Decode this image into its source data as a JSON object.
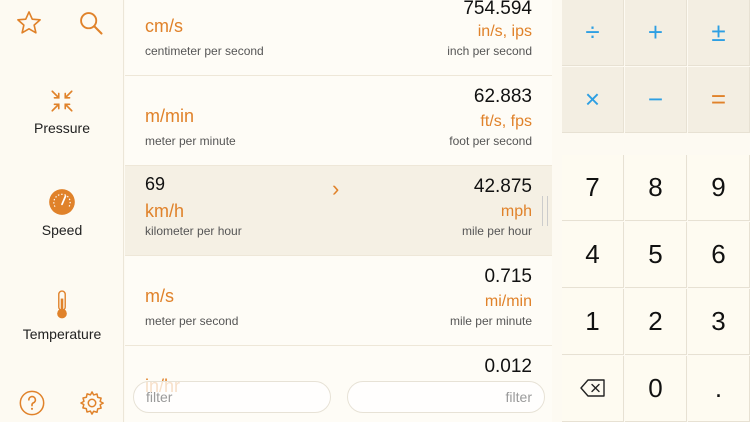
{
  "sidebar": {
    "top": {
      "favorites_icon": "star-icon",
      "search_icon": "search-icon"
    },
    "categories": [
      {
        "label": "Pressure",
        "icon": "pressure-icon"
      },
      {
        "label": "Speed",
        "icon": "speedometer-icon"
      },
      {
        "label": "Temperature",
        "icon": "thermometer-icon"
      }
    ],
    "bottom": {
      "help_icon": "help-icon",
      "settings_icon": "gear-icon"
    }
  },
  "rows": [
    {
      "left_value": "",
      "left_unit": "cm/s",
      "left_desc": "centimeter per second",
      "right_value": "754.594",
      "right_unit": "in/s, ips",
      "right_desc": "inch per second"
    },
    {
      "left_value": "",
      "left_unit": "m/min",
      "left_desc": "meter per minute",
      "right_value": "62.883",
      "right_unit": "ft/s, fps",
      "right_desc": "foot per second"
    },
    {
      "left_value": "69",
      "left_unit": "km/h",
      "left_desc": "kilometer per hour",
      "right_value": "42.875",
      "right_unit": "mph",
      "right_desc": "mile per hour"
    },
    {
      "left_value": "",
      "left_unit": "m/s",
      "left_desc": "meter per second",
      "right_value": "0.715",
      "right_unit": "mi/min",
      "right_desc": "mile per minute"
    },
    {
      "left_value": "",
      "left_unit": "in/hr",
      "left_desc": "",
      "right_value": "0.012",
      "right_unit": "",
      "right_desc": ""
    }
  ],
  "filters": {
    "left_placeholder": "filter",
    "right_placeholder": "filter"
  },
  "keypad": {
    "ops": [
      "÷",
      "+",
      "±",
      "×",
      "−",
      "="
    ],
    "digits": [
      "7",
      "8",
      "9",
      "4",
      "5",
      "6",
      "1",
      "2",
      "3",
      "",
      "0",
      "."
    ],
    "backspace_icon": "backspace-icon"
  },
  "colors": {
    "accent_orange": "#e0822a",
    "accent_blue": "#2d9fe3",
    "background": "#fdfaf2"
  }
}
